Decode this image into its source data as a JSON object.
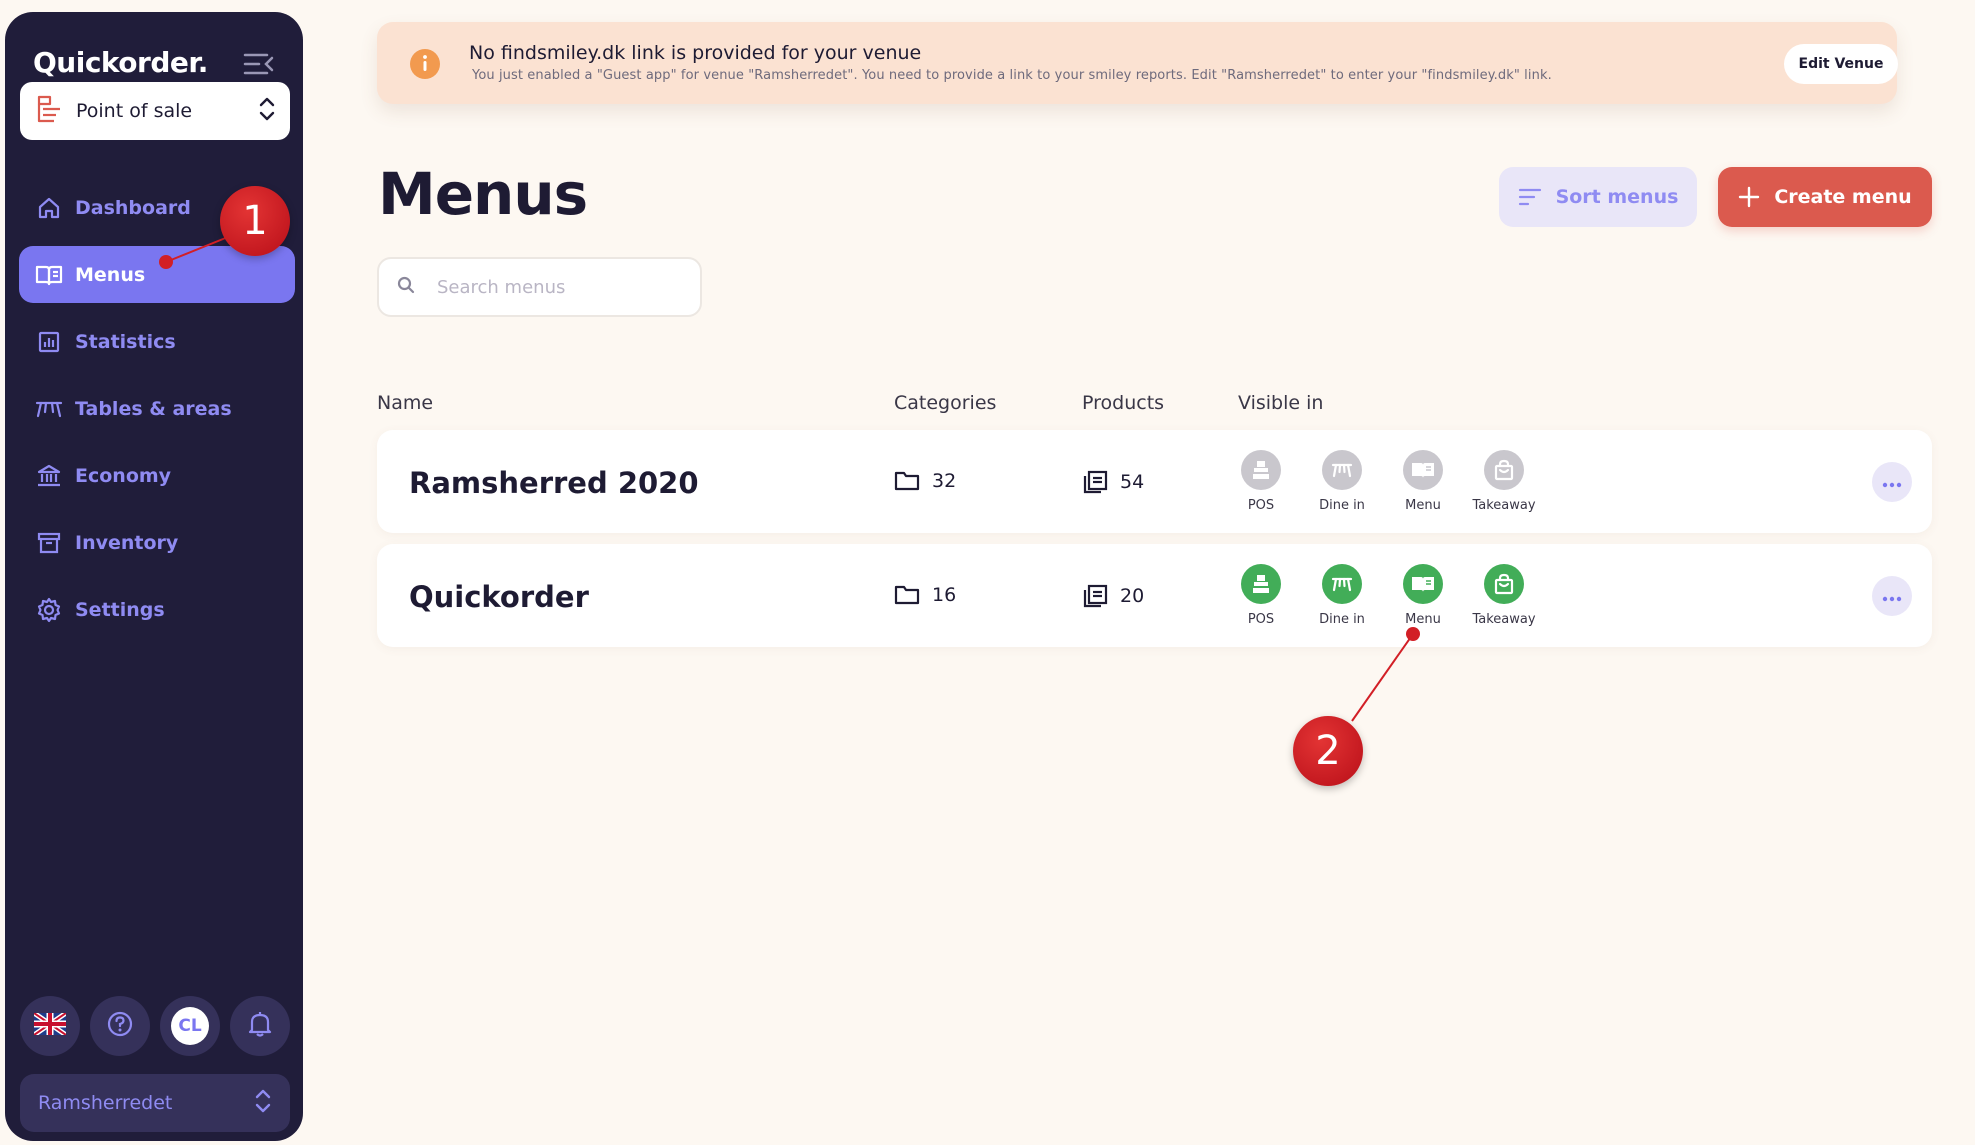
{
  "sidebar": {
    "brand": "Quickorder.",
    "mode_select": {
      "label": "Point of sale"
    },
    "nav": [
      {
        "label": "Dashboard",
        "icon": "home-icon",
        "active": false
      },
      {
        "label": "Menus",
        "icon": "book-icon",
        "active": true
      },
      {
        "label": "Statistics",
        "icon": "chart-icon",
        "active": false
      },
      {
        "label": "Tables & areas",
        "icon": "table-icon",
        "active": false
      },
      {
        "label": "Economy",
        "icon": "bank-icon",
        "active": false
      },
      {
        "label": "Inventory",
        "icon": "archive-icon",
        "active": false
      },
      {
        "label": "Settings",
        "icon": "gear-icon",
        "active": false
      }
    ],
    "avatar_initials": "CL",
    "venue_select": {
      "label": "Ramsherredet"
    }
  },
  "banner": {
    "title": "No findsmiley.dk link is provided for your venue",
    "description": "You just enabled a \"Guest app\" for venue \"Ramsherredet\". You need to provide a link to your smiley reports. Edit \"Ramsherredet\" to enter your \"findsmiley.dk\" link.",
    "action_label": "Edit Venue"
  },
  "page": {
    "title": "Menus",
    "sort_label": "Sort menus",
    "create_label": "Create menu",
    "search_placeholder": "Search menus"
  },
  "table": {
    "columns": {
      "name": "Name",
      "categories": "Categories",
      "products": "Products",
      "visible_in": "Visible in"
    },
    "rows": [
      {
        "name": "Ramsherred 2020",
        "categories": "32",
        "products": "54",
        "channels": [
          {
            "label": "POS",
            "enabled": false
          },
          {
            "label": "Dine in",
            "enabled": false
          },
          {
            "label": "Menu",
            "enabled": false
          },
          {
            "label": "Takeaway",
            "enabled": false
          }
        ]
      },
      {
        "name": "Quickorder",
        "categories": "16",
        "products": "20",
        "channels": [
          {
            "label": "POS",
            "enabled": true
          },
          {
            "label": "Dine in",
            "enabled": true
          },
          {
            "label": "Menu",
            "enabled": true
          },
          {
            "label": "Takeaway",
            "enabled": true
          }
        ]
      }
    ]
  },
  "annotations": [
    {
      "label": "1",
      "target": "Menus"
    },
    {
      "label": "2",
      "target": "Menu"
    }
  ],
  "colors": {
    "sidebar_bg": "#201d3a",
    "accent": "#7a76f0",
    "create": "#db5a4e",
    "enabled": "#42ad58",
    "disabled": "#c9c7cd",
    "annotation": "#d21f26"
  }
}
